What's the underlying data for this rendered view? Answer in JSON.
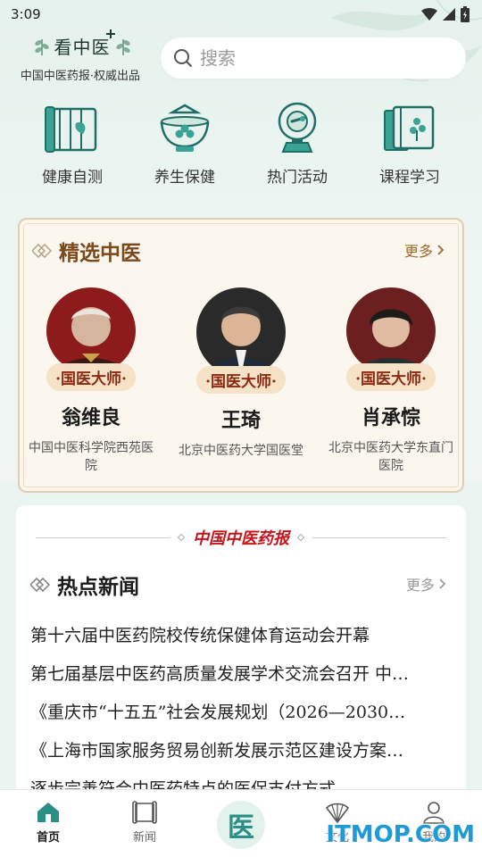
{
  "status_bar": {
    "time": "3:09"
  },
  "header": {
    "logo_title": "看中医",
    "logo_subtitle": "中国中医药报·权威出品",
    "search": {
      "placeholder": "搜索"
    }
  },
  "quick_nav": [
    {
      "label": "健康自测",
      "icon": "bamboo-scroll-icon"
    },
    {
      "label": "养生保健",
      "icon": "tea-bowl-icon"
    },
    {
      "label": "热门活动",
      "icon": "compass-plate-icon"
    },
    {
      "label": "课程学习",
      "icon": "book-icon"
    }
  ],
  "featured": {
    "title": "精选中医",
    "more_label": "更多",
    "doctors": [
      {
        "badge": "·国医大师·",
        "name": "翁维良",
        "institution": "中国中医科学院西苑医院"
      },
      {
        "badge": "·国医大师·",
        "name": "王琦",
        "institution": "北京中医药大学国医堂"
      },
      {
        "badge": "·国医大师·",
        "name": "肖承悰",
        "institution": "北京中医药大学东直门医院"
      }
    ]
  },
  "news": {
    "brand": "中国中医药报",
    "title": "热点新闻",
    "more_label": "更多",
    "items": [
      "第十六届中医药院校传统保健体育运动会开幕",
      "第七届基层中医药高质量发展学术交流会召开 中…",
      "《重庆市“十五五”社会发展规划（2026—2030…",
      "《上海市国家服务贸易创新发展示范区建设方案…",
      "逐步完善符合中医药特点的医保支付方式"
    ]
  },
  "bottom_nav": [
    {
      "label": "首页",
      "active": true
    },
    {
      "label": "新闻",
      "active": false
    },
    {
      "label": "",
      "center_glyph": "医"
    },
    {
      "label": "文化",
      "active": false
    },
    {
      "label": "我的",
      "active": false
    }
  ],
  "watermark": "ITMOP.COM",
  "colors": {
    "accent_green": "#2a8f84",
    "featured_title": "#7a4a1c",
    "badge_bg": "#f6e2c6",
    "badge_text": "#8c2a12",
    "brand_red": "#c4161c"
  }
}
